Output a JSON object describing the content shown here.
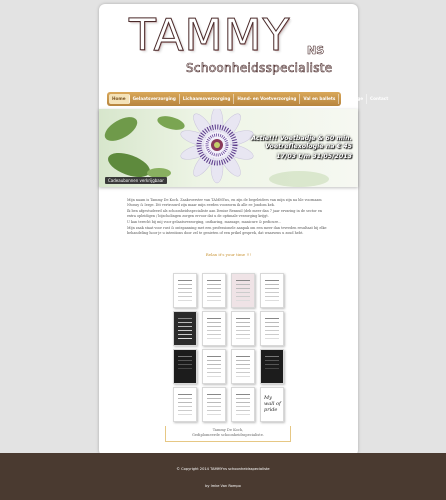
{
  "logo": {
    "title": "TAMMY",
    "suffix": "NS",
    "subtitle": "Schoonheidsspecialiste"
  },
  "nav": {
    "items": [
      {
        "label": "Home",
        "active": true
      },
      {
        "label": "Gelaatsverzorging"
      },
      {
        "label": "Lichaamsverzorging"
      },
      {
        "label": "Hand- en Voetverzorging"
      },
      {
        "label": "Val en ballets"
      },
      {
        "label": "Massage"
      },
      {
        "label": "Contact"
      }
    ]
  },
  "banner": {
    "line1": "Actie!!! Voetbadje & 60 min.",
    "line2": "Voetreflexologie na € 45",
    "line3": "17/03 t/m 31/05/2013",
    "caption": "Cadeaubonnen verkrijgbaar"
  },
  "content": {
    "p1": "Mijn naam is Tammy De Koch. Zaakvoerster van TAMMYns, en zijn de begeleiders van mijn zijn na hle voornaam Ntonsy & Ierge. Dit vertrouwd zijn maar mijn eerden voorzorm ik alle ee Jondom kek.",
    "p2": "Ik ben afgestudeerd als schoonheidsspecialiste aan Denise Rennuil (deb meer dan 7 jaar ervaring in de sector en extra opleidigen / bijscholingen zorgen ervoor dat u de optimale verzorging krijgt.",
    "p3": "U kan terecht bij mij voor gelaatsverzorging, ontharing, massage, manicure & pedicure...",
    "p4": "Mijn zaak staat voor rust & ontspanning met een professionele aanpak om een meer dan tevreden resultaat bij elke behandeling hoor je u intentions door zel te genieten of een prikel gesprek, dat waarsens u zoud hebt."
  },
  "cta": "Relax it's your time !!!",
  "certificates": {
    "note_text": "My wall of pride"
  },
  "signature": {
    "line1": "Tammy De Koch,",
    "line2": "Gediplomeerde schoonheidsspecialiste."
  },
  "footer": {
    "copyright": "© Copyright 2014 TAMMYns schoonheidsspecialiste",
    "credit": "by Imke Van Rompo"
  },
  "colors": {
    "nav_gold": "#c99435",
    "footer": "#4a3a30",
    "background": "#e3e3e3"
  }
}
